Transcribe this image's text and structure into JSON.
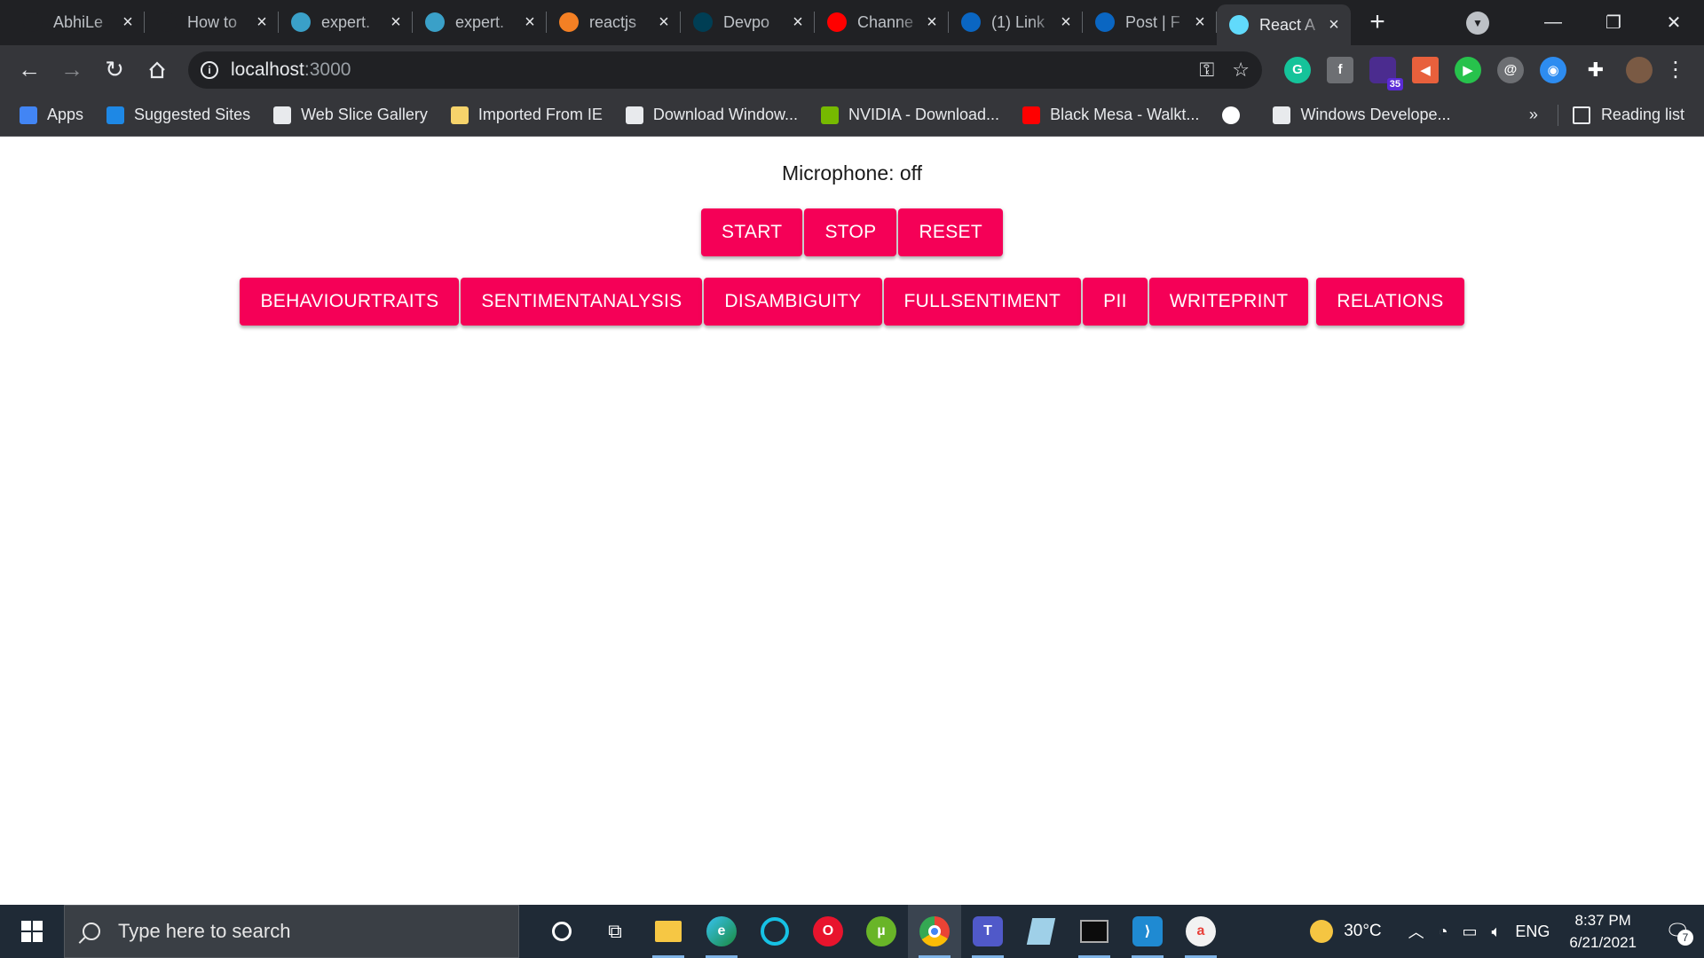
{
  "tabs": [
    {
      "title": "AbhiLe",
      "favicon": "github-icon",
      "color": "#202124"
    },
    {
      "title": "How to",
      "favicon": "github-icon",
      "color": "#202124"
    },
    {
      "title": "expert.",
      "favicon": "expertai-icon",
      "color": "#3aa0c8"
    },
    {
      "title": "expert.",
      "favicon": "expertai-icon",
      "color": "#3aa0c8"
    },
    {
      "title": "reactjs",
      "favicon": "stackoverflow-icon",
      "color": "#f48024"
    },
    {
      "title": "Devpo",
      "favicon": "devpost-icon",
      "color": "#003e54"
    },
    {
      "title": "Channe",
      "favicon": "youtube-icon",
      "color": "#ff0000"
    },
    {
      "title": "(1) Link",
      "favicon": "linkedin-icon",
      "color": "#0a66c2"
    },
    {
      "title": "Post | F",
      "favicon": "linkedin-icon",
      "color": "#0a66c2"
    },
    {
      "title": "React A",
      "favicon": "react-icon",
      "color": "#61dafb",
      "active": true
    }
  ],
  "address": {
    "host": "localhost",
    "port": ":3000"
  },
  "bookmarks": [
    {
      "label": "Apps",
      "icon": "apps-grid-icon",
      "color": "#4285f4"
    },
    {
      "label": "Suggested Sites",
      "icon": "bing-icon",
      "color": "#1e88e5"
    },
    {
      "label": "Web Slice Gallery",
      "icon": "web-slice-icon",
      "color": "#e8eaed"
    },
    {
      "label": "Imported From IE",
      "icon": "folder-icon",
      "color": "#f6d36b"
    },
    {
      "label": "Download Window...",
      "icon": "globe-icon",
      "color": "#e8eaed"
    },
    {
      "label": "NVIDIA - Download...",
      "icon": "nvidia-icon",
      "color": "#76b900"
    },
    {
      "label": "Black Mesa - Walkt...",
      "icon": "youtube-icon",
      "color": "#ff0000"
    },
    {
      "label": "",
      "icon": "google-icon",
      "color": "#ffffff"
    },
    {
      "label": "Windows Develope...",
      "icon": "globe-icon",
      "color": "#e8eaed"
    }
  ],
  "bookmarks_right": {
    "overflow": "»",
    "reading_list": "Reading list"
  },
  "extensions": {
    "badge": "35"
  },
  "page": {
    "microphone_status": "Microphone: off",
    "controls": [
      "START",
      "STOP",
      "RESET"
    ],
    "analysis_buttons": [
      "BEHAVIOURTRAITS",
      "SENTIMENTANALYSIS",
      "DISAMBIGUITY",
      "FULLSENTIMENT",
      "PII",
      "WRITEPRINT",
      "RELATIONS"
    ],
    "accent_color": "#f50057"
  },
  "taskbar": {
    "search_placeholder": "Type here to search",
    "weather_temp": "30°C",
    "language": "ENG",
    "time": "8:37 PM",
    "date": "6/21/2021",
    "notifications": "7"
  }
}
